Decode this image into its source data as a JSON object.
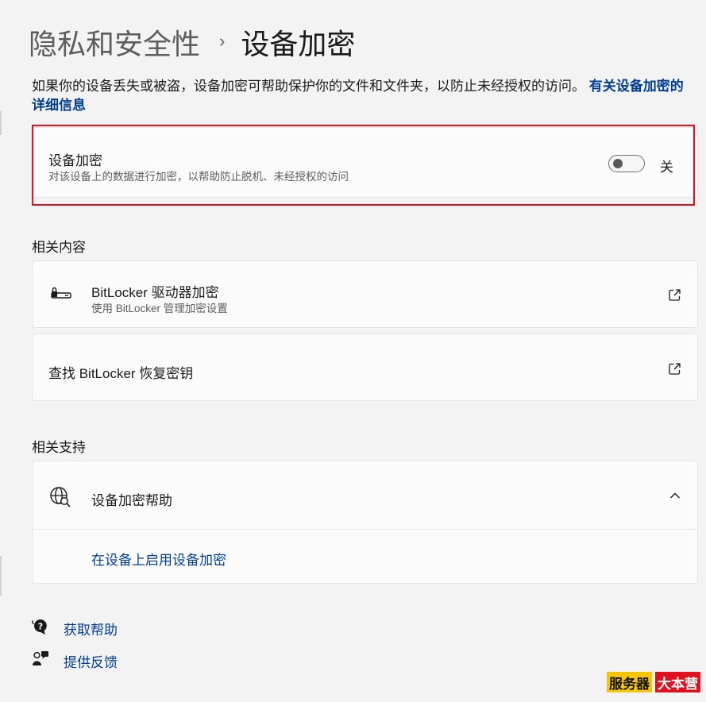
{
  "header": {
    "parent": "隐私和安全性",
    "separator": "›",
    "current": "设备加密"
  },
  "intro": {
    "text": "如果你的设备丢失或被盗，设备加密可帮助保护你的文件和文件夹，以防止未经授权的访问。",
    "link": "有关设备加密的详细信息"
  },
  "device_encryption": {
    "title": "设备加密",
    "subtitle": "对该设备上的数据进行加密，以帮助防止脱机、未经授权的访问",
    "toggle_state": "关",
    "toggle_on": false
  },
  "related_content": {
    "heading": "相关内容",
    "items": [
      {
        "title": "BitLocker 驱动器加密",
        "subtitle": "使用 BitLocker 管理加密设置",
        "icon": "bitlocker-drive-icon",
        "action_icon": "external-link-icon"
      },
      {
        "title": "查找 BitLocker 恢复密钥",
        "action_icon": "external-link-icon"
      }
    ]
  },
  "related_support": {
    "heading": "相关支持",
    "help_title": "设备加密帮助",
    "help_icon": "globe-icon",
    "expanded": true,
    "links": [
      "在设备上启用设备加密"
    ]
  },
  "footer": {
    "get_help": "获取帮助",
    "feedback": "提供反馈"
  },
  "watermark": {
    "left": "服务器",
    "right": "大本营"
  },
  "colors": {
    "accent_link": "#003e92",
    "highlight_border": "#e0101f",
    "background": "#f3f3f3",
    "card": "#fbfbfb",
    "watermark_yellow": "#f7c600",
    "watermark_red": "#e0101f"
  }
}
